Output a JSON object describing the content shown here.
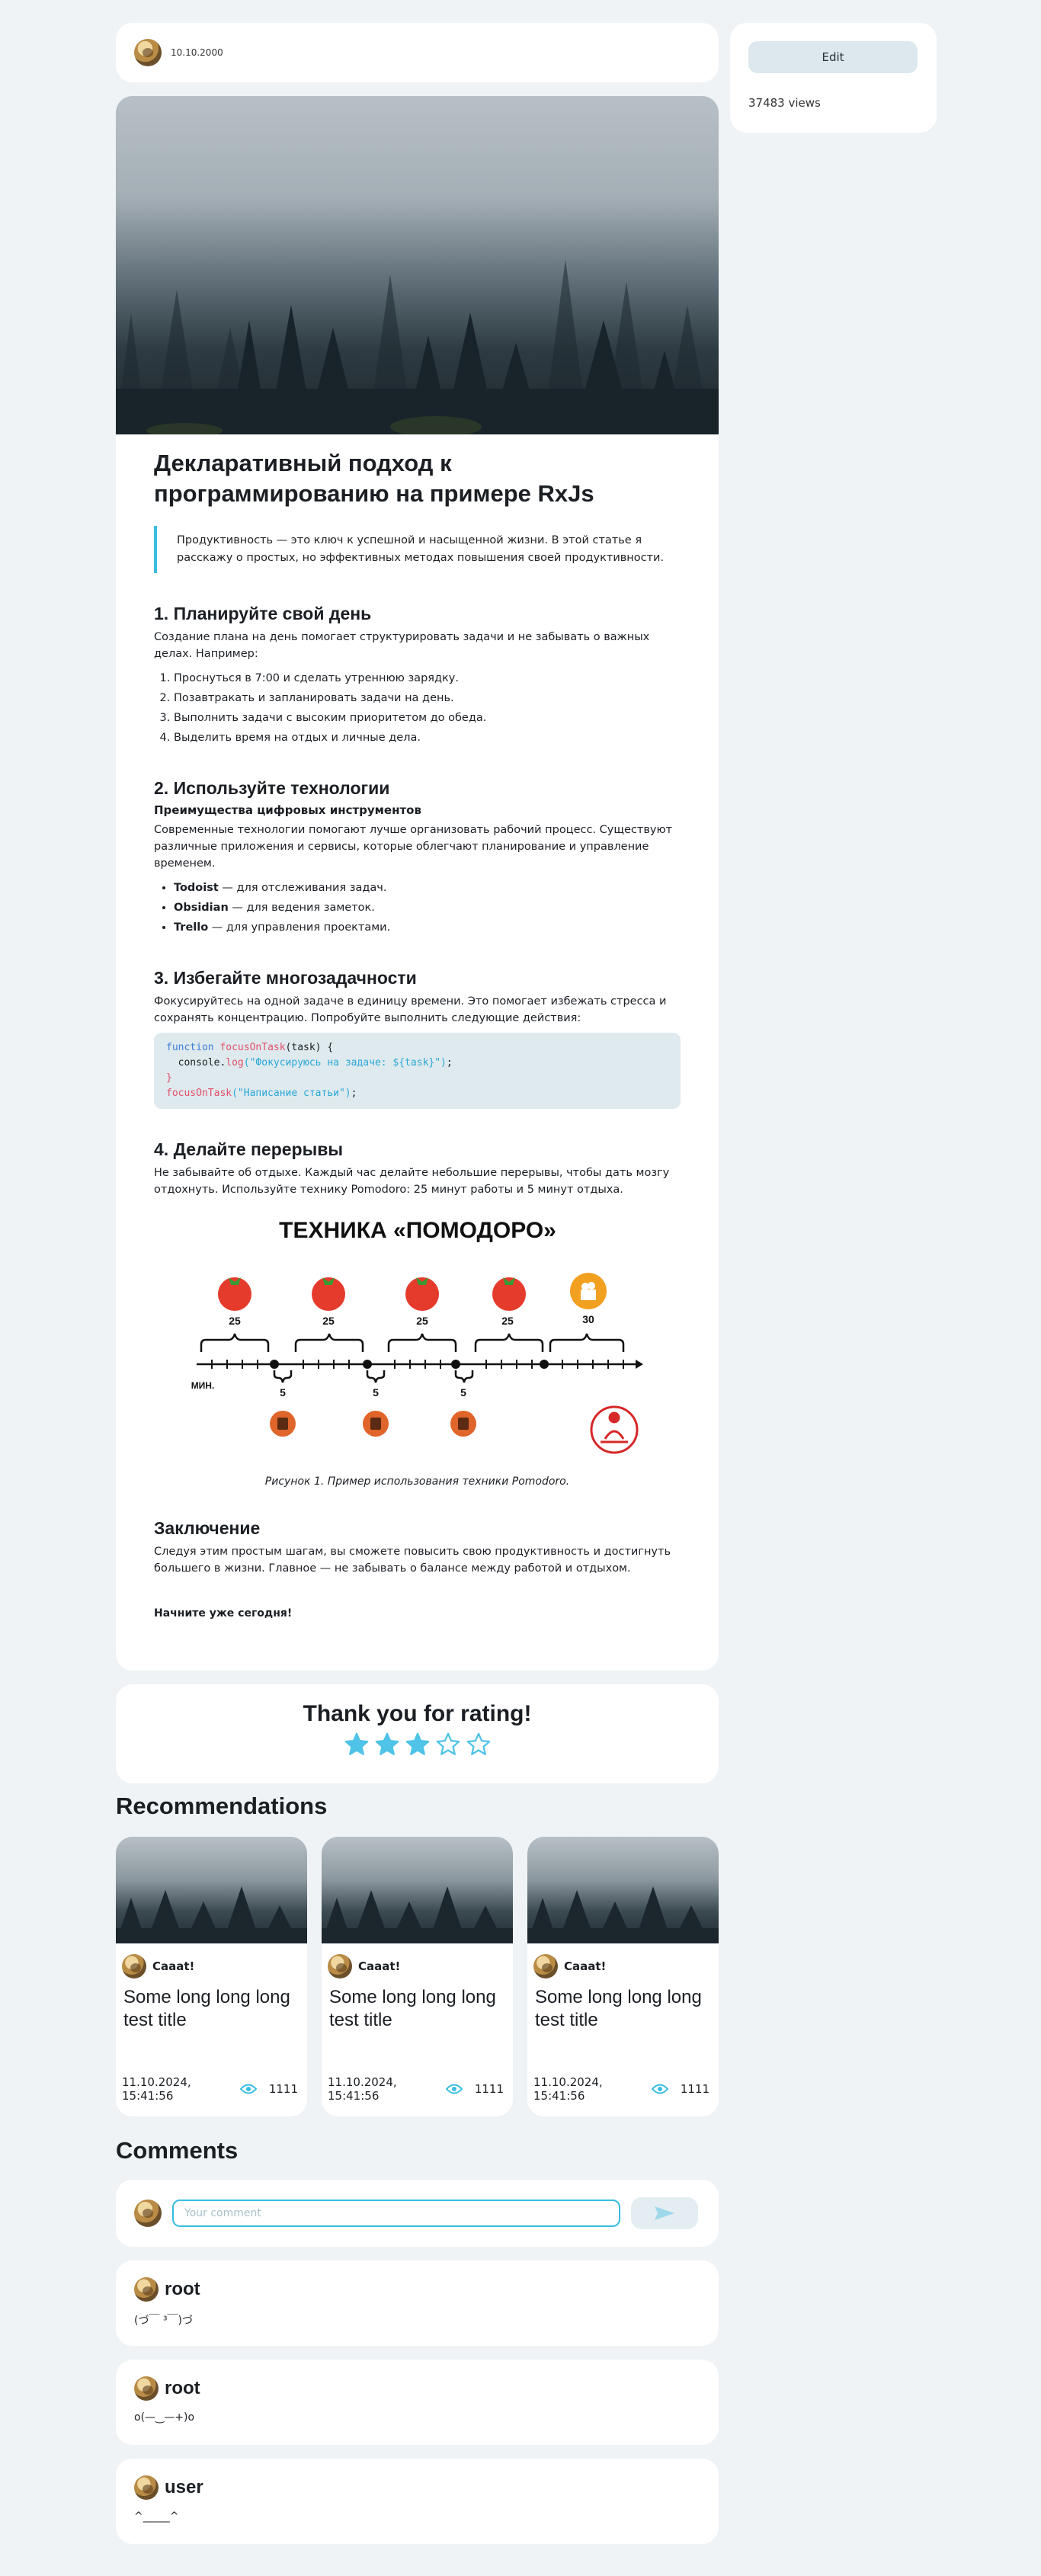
{
  "header": {
    "date": "10.10.2000"
  },
  "side": {
    "edit_label": "Edit",
    "views": "37483 views"
  },
  "article": {
    "title": "Декларативный подход к программированию на примере RxJs",
    "lead": "Продуктивность — это ключ к успешной и насыщенной жизни. В этой статье я расскажу о простых, но эффективных методах повышения своей продуктивности.",
    "s1": {
      "heading": "1. Планируйте свой день",
      "text": "Создание плана на день помогает структурировать задачи и не забывать о важных делах. Например:",
      "items": [
        "Проснуться в 7:00 и сделать утреннюю зарядку.",
        "Позавтракать и запланировать задачи на день.",
        "Выполнить задачи с высоким приоритетом до обеда.",
        "Выделить время на отдых и личные дела."
      ]
    },
    "s2": {
      "heading": "2. Используйте технологии",
      "sub": "Преимущества цифровых инструментов",
      "text": "Современные технологии помогают лучше организовать рабочий процесс. Существуют различные приложения и сервисы, которые облегчают планирование и управление временем.",
      "items": [
        {
          "name": "Todoist",
          "desc": " — для отслеживания задач."
        },
        {
          "name": "Obsidian",
          "desc": " — для ведения заметок."
        },
        {
          "name": "Trello",
          "desc": " — для управления проектами."
        }
      ]
    },
    "s3": {
      "heading": "3. Избегайте многозадачности",
      "text": "Фокусируйтесь на одной задаче в единицу времени. Это помогает избежать стресса и сохранять концентрацию. Попробуйте выполнить следующие действия:",
      "code": {
        "l1_kw": "function",
        "l1_fn": "focusOnTask",
        "l1_rest": "(task) {",
        "l2_obj": "  console.",
        "l2_fn": "log",
        "l2_str": "(\"Фокусируюсь на задаче: ${task}\")",
        "l2_end": ";",
        "l3": "}",
        "l4_fn": "focusOnTask",
        "l4_str": "(\"Написание статьи\")",
        "l4_end": ";"
      }
    },
    "s4": {
      "heading": "4. Делайте перерывы",
      "text": "Не забывайте об отдыхе. Каждый час делайте небольшие перерывы, чтобы дать мозгу отдохнуть. Используйте технику Pomodoro: 25 минут работы и 5 минут отдыха.",
      "figure": {
        "title": "ТЕХНИКА «ПОМОДОРО»",
        "work_labels": [
          "25",
          "25",
          "25",
          "25",
          "30"
        ],
        "break_labels": [
          "5",
          "5",
          "5"
        ],
        "axis_label": "МИН."
      },
      "caption": "Рисунок 1. Пример использования техники Pomodoro."
    },
    "conclusion": {
      "heading": "Заключение",
      "text": "Следуя этим простым шагам, вы сможете повысить свою продуктивность и достигнуть большего в жизни. Главное — не забывать о балансе между работой и отдыхом.",
      "cta": "Начните уже сегодня!"
    }
  },
  "rating": {
    "title": "Thank you for rating!",
    "value": 3,
    "max": 5,
    "color": "#4fc3e8"
  },
  "recommendations": {
    "title": "Recommendations",
    "items": [
      {
        "author": "Caaat!",
        "title": "Some long long long test title",
        "date": "11.10.2024,",
        "time": "15:41:56",
        "views": "1111"
      },
      {
        "author": "Caaat!",
        "title": "Some long long long test title",
        "date": "11.10.2024,",
        "time": "15:41:56",
        "views": "1111"
      },
      {
        "author": "Caaat!",
        "title": "Some long long long test title",
        "date": "11.10.2024,",
        "time": "15:41:56",
        "views": "1111"
      }
    ]
  },
  "comments": {
    "title": "Comments",
    "placeholder": "Your comment",
    "items": [
      {
        "user": "root",
        "text": "(づ￣ ³￣)づ"
      },
      {
        "user": "root",
        "text": "o(—‿—+)o"
      },
      {
        "user": "user",
        "text": "^_____^"
      }
    ]
  }
}
